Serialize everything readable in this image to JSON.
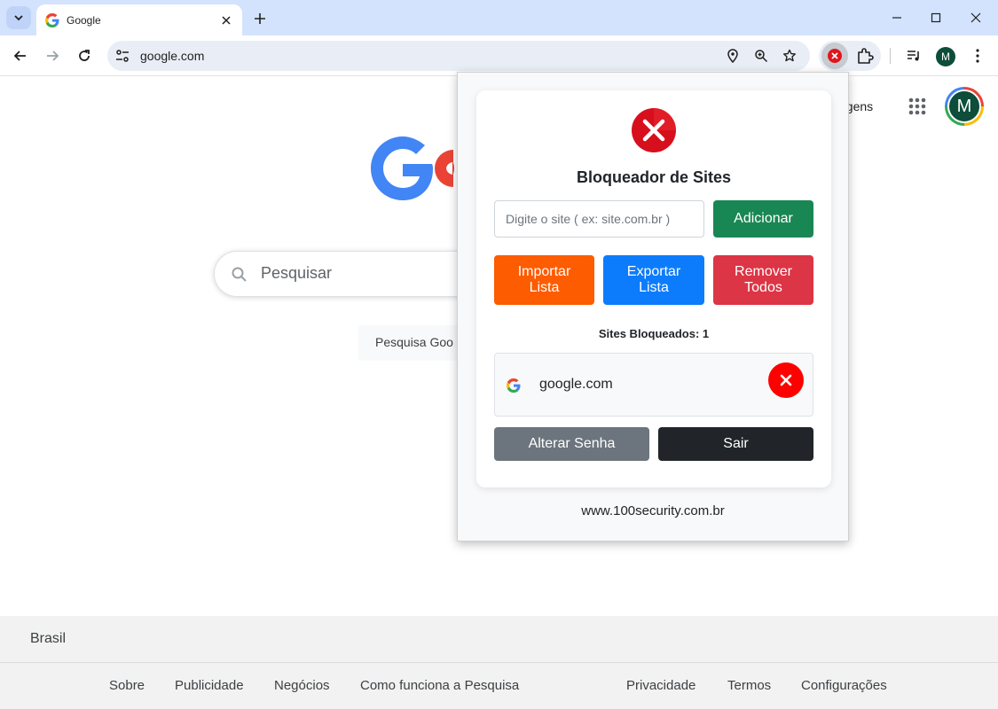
{
  "browser": {
    "tab_title": "Google",
    "url": "google.com",
    "profile_initial": "M"
  },
  "page": {
    "images_link": "agens",
    "profile_initial": "M",
    "search_placeholder": "Pesquisar",
    "search_button": "Pesquisa Goo",
    "footer": {
      "country": "Brasil",
      "links_left": [
        "Sobre",
        "Publicidade",
        "Negócios",
        "Como funciona a Pesquisa"
      ],
      "links_right": [
        "Privacidade",
        "Termos",
        "Configurações"
      ]
    }
  },
  "popup": {
    "title": "Bloqueador de Sites",
    "input_placeholder": "Digite o site ( ex: site.com.br )",
    "add_button": "Adicionar",
    "import_button": "Importar Lista",
    "export_button": "Exportar Lista",
    "remove_all_button": "Remover Todos",
    "blocked_count_label": "Sites Bloqueados: 1",
    "blocked_sites": [
      {
        "domain": "google.com"
      }
    ],
    "change_password_button": "Alterar Senha",
    "exit_button": "Sair",
    "footer_text": "www.100security.com.br"
  },
  "colors": {
    "chrome_tab_strip": "#d3e3fd",
    "add": "#198754",
    "import": "#fd5c00",
    "export": "#0d7cfc",
    "remove": "#dc3545",
    "delete_circle": "#ff0000",
    "change_password": "#6c757d",
    "exit": "#212529"
  }
}
